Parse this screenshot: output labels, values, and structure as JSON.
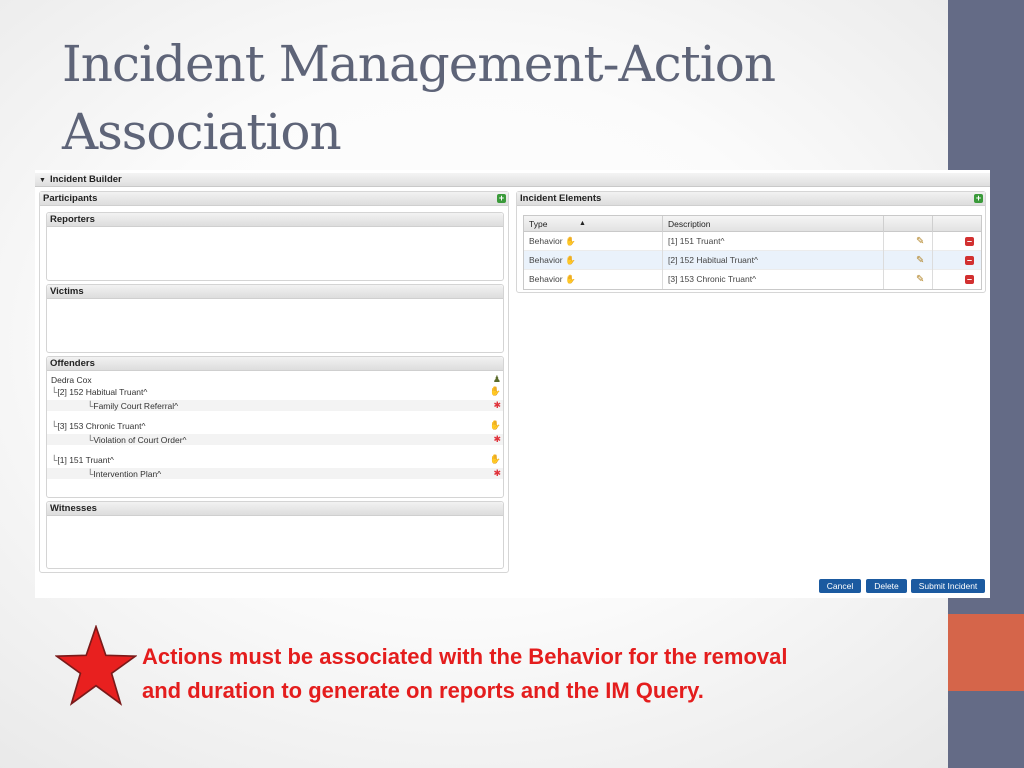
{
  "slide": {
    "title_line1": "Incident Management-Action",
    "title_line2": "Association",
    "note_line1": "Actions must be associated with the Behavior for the removal",
    "note_line2": "and duration to generate on reports and the IM Query.",
    "note_icon": "star-icon",
    "colors": {
      "sidebar": "#646b86",
      "accent": "#d5654a",
      "note": "#e41d1d",
      "star": "#e8201f"
    }
  },
  "builder": {
    "section_title": "Incident Builder",
    "participants": {
      "title": "Participants",
      "reporters": {
        "title": "Reporters"
      },
      "victims": {
        "title": "Victims"
      },
      "offenders": {
        "title": "Offenders",
        "name": "Dedra Cox",
        "behaviors": [
          {
            "label": "[2] 152 Habitual Truant^",
            "action": "Family Court Referral^"
          },
          {
            "label": "[3] 153 Chronic Truant^",
            "action": "Violation of Court Order^"
          },
          {
            "label": "[1] 151 Truant^",
            "action": "Intervention Plan^"
          }
        ]
      },
      "witnesses": {
        "title": "Witnesses"
      }
    },
    "elements": {
      "title": "Incident Elements",
      "columns": {
        "type": "Type",
        "description": "Description"
      },
      "rows": [
        {
          "type": "Behavior",
          "description": "[1] 151 Truant^"
        },
        {
          "type": "Behavior",
          "description": "[2] 152 Habitual Truant^"
        },
        {
          "type": "Behavior",
          "description": "[3] 153 Chronic Truant^"
        }
      ]
    },
    "buttons": {
      "cancel": "Cancel",
      "delete": "Delete",
      "submit": "Submit Incident"
    }
  }
}
